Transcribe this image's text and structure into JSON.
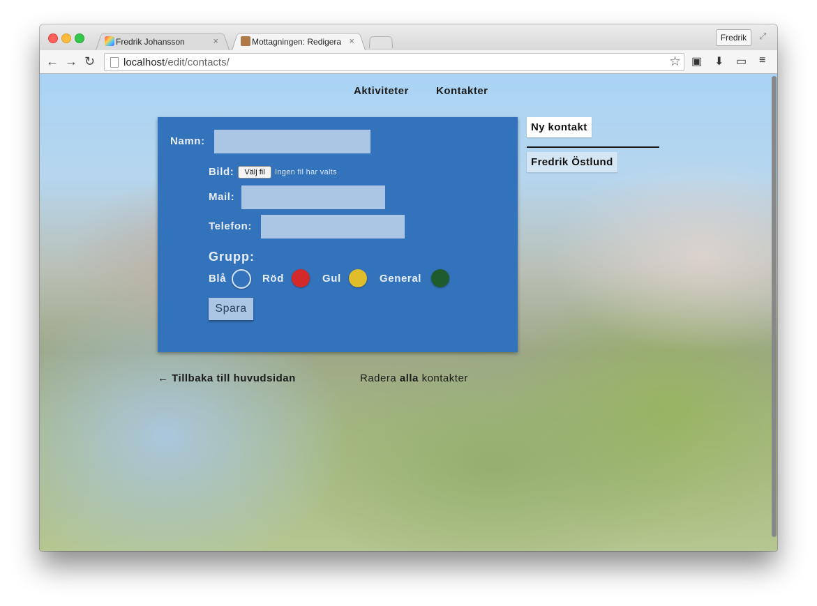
{
  "browser": {
    "tabs": [
      {
        "label": "Fredrik Johansson",
        "close": "×"
      },
      {
        "label": "Mottagningen: Redigera",
        "close": "×"
      }
    ],
    "profile": "Fredrik",
    "url_host": "localhost",
    "url_path": "/edit/contacts/"
  },
  "nav": {
    "activities": "Aktiviteter",
    "contacts": "Kontakter"
  },
  "form": {
    "name_label": "Namn:",
    "name_value": "",
    "image_label": "Bild:",
    "file_button": "Välj fil",
    "file_status": "Ingen fil har valts",
    "mail_label": "Mail:",
    "mail_value": "",
    "phone_label": "Telefon:",
    "phone_value": "",
    "group_heading": "Grupp:",
    "groups": [
      {
        "label": "Blå",
        "color": "#3373bc",
        "selected": true
      },
      {
        "label": "Röd",
        "color": "#d22a2a",
        "selected": false
      },
      {
        "label": "Gul",
        "color": "#dfbd2b",
        "selected": false
      },
      {
        "label": "General",
        "color": "#1f5c2c",
        "selected": false
      }
    ],
    "save_button": "Spara"
  },
  "sidebar": {
    "new_contact": "Ny kontakt",
    "contacts": [
      "Fredrik Östlund"
    ]
  },
  "footer": {
    "back_link": "← Tillbaka till huvudsidan",
    "delete_prefix": "Radera",
    "delete_bold": "alla",
    "delete_suffix": "kontakter"
  },
  "colors": {
    "panel": "#3373bc",
    "input": "#aac6e4"
  }
}
